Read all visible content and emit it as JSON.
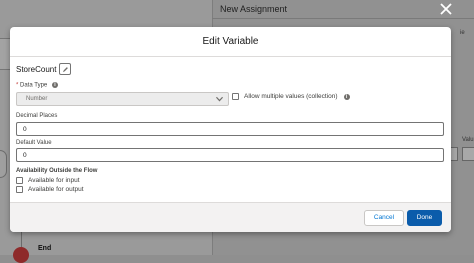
{
  "background": {
    "panel_title": "New Assignment",
    "end_label": "End",
    "partial_ite": "ite",
    "partial_ie": "ie",
    "partial_valu": "Valu"
  },
  "modal": {
    "title": "Edit Variable",
    "variable_name": "StoreCount",
    "data_type": {
      "label": "Data Type",
      "required_mark": "*",
      "value": "Number"
    },
    "multiple_values": {
      "label": "Allow multiple values (collection)",
      "checked": false
    },
    "decimal_places": {
      "label": "Decimal Places",
      "value": "0"
    },
    "default_value": {
      "label": "Default Value",
      "value": "0"
    },
    "availability": {
      "title": "Availability Outside the Flow",
      "input_label": "Available for input",
      "output_label": "Available for output"
    },
    "buttons": {
      "cancel": "Cancel",
      "done": "Done"
    }
  },
  "colors": {
    "brand": "#0b5cab",
    "required": "#c23934"
  }
}
